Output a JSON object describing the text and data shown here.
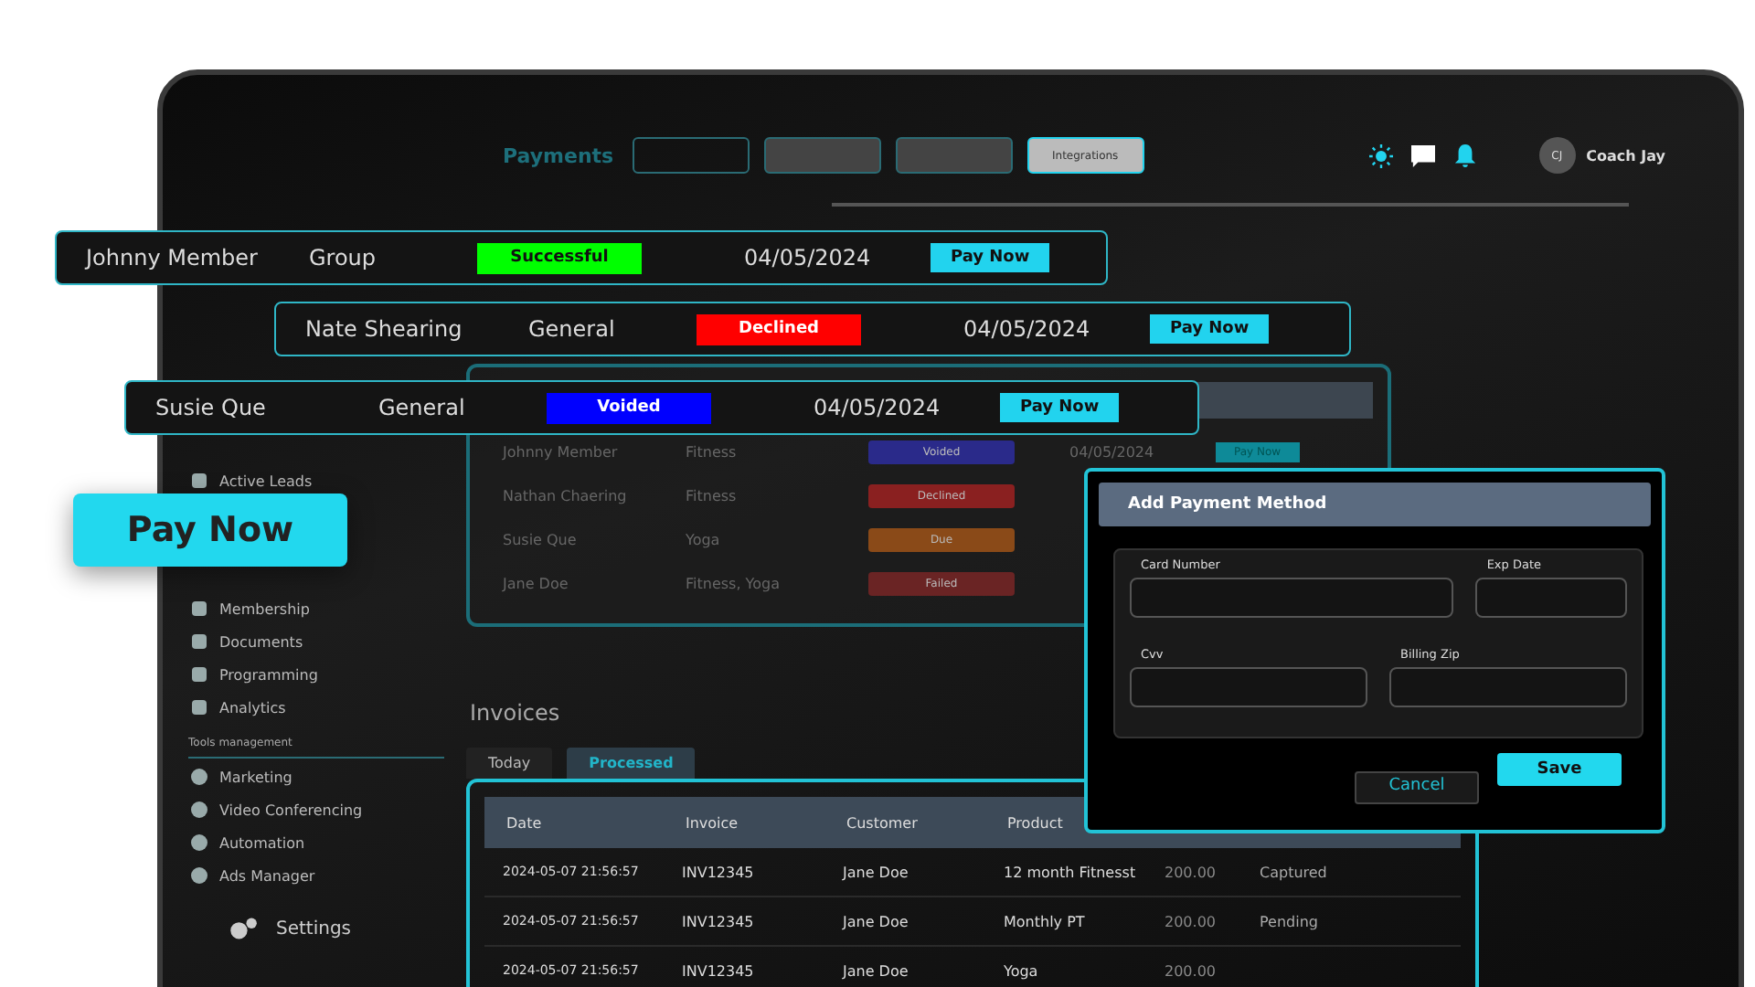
{
  "header": {
    "title": "Payments",
    "tabs": [
      {
        "label": "Integrations",
        "selected": false
      }
    ],
    "user": {
      "initials": "CJ",
      "name": "Coach Jay"
    }
  },
  "sidebar": {
    "items": [
      {
        "label": "Active Leads"
      },
      {
        "label": "Membership"
      },
      {
        "label": "Documents"
      },
      {
        "label": "Programming"
      },
      {
        "label": "Analytics"
      }
    ],
    "section": "Tools management",
    "tools": [
      {
        "label": "Marketing"
      },
      {
        "label": "Video Conferencing"
      },
      {
        "label": "Automation"
      },
      {
        "label": "Ads Manager"
      }
    ],
    "settings": "Settings"
  },
  "payments_table": {
    "rows": [
      {
        "name": "Johnny Member",
        "type": "Fitness",
        "status": "Voided",
        "color": "#2a2a8a",
        "date": "04/05/2024",
        "action": "Pay Now"
      },
      {
        "name": "Nathan Chaering",
        "type": "Fitness",
        "status": "Declined",
        "color": "#8a2020"
      },
      {
        "name": "Susie Que",
        "type": "Yoga",
        "status": "Due",
        "color": "#8a4a18"
      },
      {
        "name": "Jane Doe",
        "type": "Fitness, Yoga",
        "status": "Failed",
        "color": "#6a2424"
      }
    ]
  },
  "invoices": {
    "title": "Invoices",
    "tabs": [
      {
        "label": "Today",
        "selected": false
      },
      {
        "label": "Processed",
        "selected": true
      }
    ],
    "columns": [
      "Date",
      "Invoice",
      "Customer",
      "Product"
    ],
    "rows": [
      {
        "cells": [
          "2024-05-07 21:56:57",
          "INV12345",
          "Jane Doe",
          "12 month Fitnesst",
          "200.00",
          "Captured"
        ]
      },
      {
        "cells": [
          "2024-05-07 21:56:57",
          "INV12345",
          "Jane Doe",
          "Monthly PT",
          "200.00",
          "Pending"
        ]
      },
      {
        "cells": [
          "2024-05-07 21:56:57",
          "INV12345",
          "Jane Doe",
          "Yoga",
          "200.00"
        ]
      }
    ]
  },
  "floating_rows": [
    {
      "name": "Johnny Member",
      "type": "Group",
      "status": "Successful",
      "color": "#00ff00",
      "date": "04/05/2024",
      "action": "Pay Now"
    },
    {
      "name": "Nate Shearing",
      "type": "General",
      "status": "Declined",
      "color": "#ff0000",
      "date": "04/05/2024",
      "action": "Pay Now"
    },
    {
      "name": "Susie Que",
      "type": "General",
      "status": "Voided",
      "color": "#0000ff",
      "date": "04/05/2024",
      "action": "Pay Now"
    }
  ],
  "pay_now_button": "Pay Now",
  "modal": {
    "title": "Add Payment Method",
    "fields": [
      {
        "label": "Card Number"
      },
      {
        "label": "Exp Date"
      },
      {
        "label": "Cvv"
      },
      {
        "label": "Billing Zip"
      }
    ],
    "buttons": [
      {
        "label": "Cancel",
        "kind": "secondary"
      },
      {
        "label": "Save",
        "kind": "primary"
      }
    ]
  }
}
